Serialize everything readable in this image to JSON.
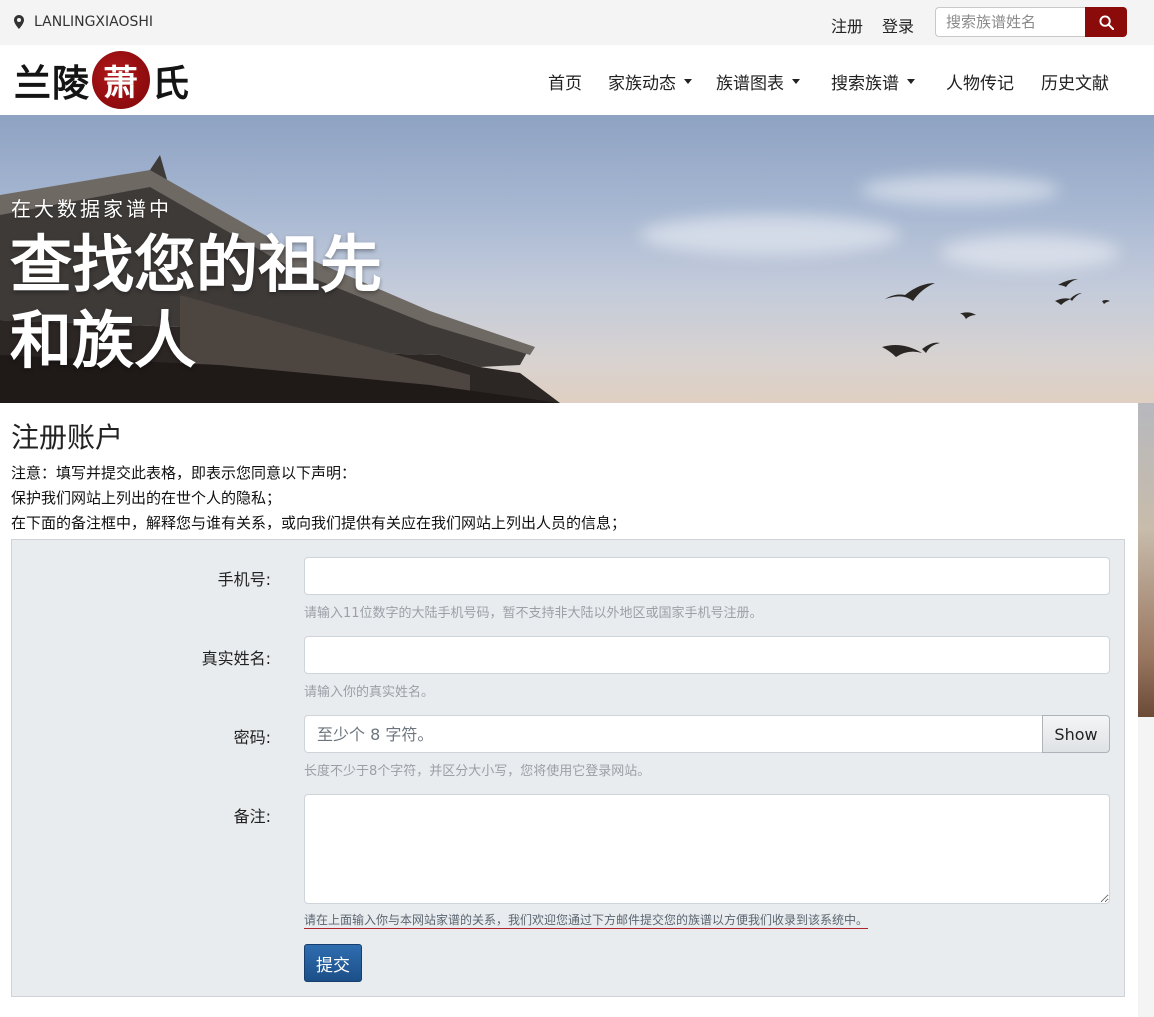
{
  "topbar": {
    "location_icon": "map-marker-icon",
    "site_code": "LANLINGXIAOSHI",
    "register": "注册",
    "login": "登录",
    "search_placeholder": "搜索族谱姓名",
    "search_icon": "search-icon",
    "accent_color": "#8b0b0b"
  },
  "logo": {
    "left": "兰陵",
    "seal": "萧",
    "right": "氏"
  },
  "nav": {
    "items": [
      {
        "label": "首页",
        "dropdown": false
      },
      {
        "label": "家族动态",
        "dropdown": true
      },
      {
        "label": "族谱图表",
        "dropdown": true
      },
      {
        "label": "搜索族谱",
        "dropdown": true
      },
      {
        "label": "人物传记",
        "dropdown": false
      },
      {
        "label": "历史文献",
        "dropdown": false
      }
    ]
  },
  "hero": {
    "subtitle": "在大数据家谱中",
    "title_line1": "查找您的祖先",
    "title_line2": "和族人"
  },
  "page": {
    "title": "注册账户",
    "notes": [
      "注意：填写并提交此表格，即表示您同意以下声明：",
      "保护我们网站上列出的在世个人的隐私；",
      "在下面的备注框中，解释您与谁有关系，或向我们提供有关应在我们网站上列出人员的信息；"
    ]
  },
  "form": {
    "phone": {
      "label": "手机号:",
      "value": "",
      "help": "请输入11位数字的大陆手机号码，暂不支持非大陆以外地区或国家手机号注册。"
    },
    "name": {
      "label": "真实姓名:",
      "value": "",
      "help": "请输入你的真实姓名。"
    },
    "password": {
      "label": "密码:",
      "placeholder": "至少个 8 字符。",
      "show_label": "Show",
      "help": "长度不少于8个字符，并区分大小写，您将使用它登录网站。"
    },
    "remark": {
      "label": "备注:",
      "value": "",
      "help": "请在上面输入你与本网站家谱的关系，我们欢迎您通过下方邮件提交您的族谱以方便我们收录到该系统中。"
    },
    "submit_label": "提交",
    "submit_color": "#1f5590"
  }
}
